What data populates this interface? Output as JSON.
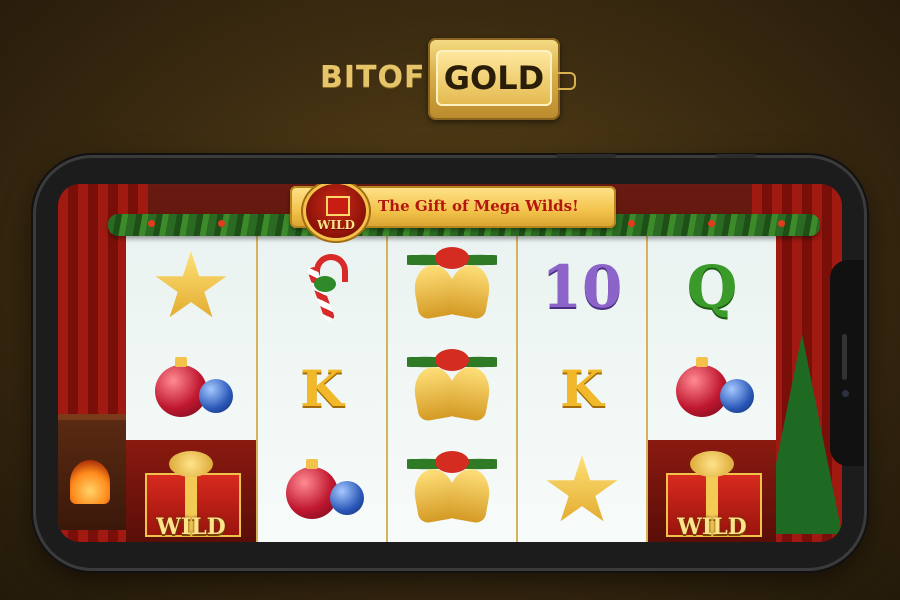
{
  "brand": {
    "prefix": "BITOF",
    "boxed": "GOLD"
  },
  "game": {
    "banner_text": "The Gift of Mega Wilds!",
    "banner_badge_label": "WILD",
    "colors": {
      "banner": "#f2c24a",
      "banner_text": "#b3160e",
      "reel_bg": "#eef6f3",
      "frame": "#1c1c1c"
    },
    "reels": [
      {
        "cells": [
          {
            "symbol": "star-icon"
          },
          {
            "symbol": "ornaments-icon"
          },
          {
            "symbol": "gift-wild-icon",
            "label": "WILD"
          }
        ]
      },
      {
        "cells": [
          {
            "symbol": "candy-cane-icon"
          },
          {
            "symbol": "letter",
            "label": "K"
          },
          {
            "symbol": "ornaments-icon"
          }
        ]
      },
      {
        "cells": [
          {
            "symbol": "bells-icon"
          },
          {
            "symbol": "bells-icon"
          },
          {
            "symbol": "bells-icon"
          }
        ]
      },
      {
        "cells": [
          {
            "symbol": "letter",
            "label": "10"
          },
          {
            "symbol": "letter",
            "label": "K"
          },
          {
            "symbol": "star-icon"
          }
        ]
      },
      {
        "cells": [
          {
            "symbol": "letter",
            "label": "Q"
          },
          {
            "symbol": "ornaments-icon"
          },
          {
            "symbol": "gift-wild-icon",
            "label": "WILD"
          }
        ]
      }
    ]
  }
}
